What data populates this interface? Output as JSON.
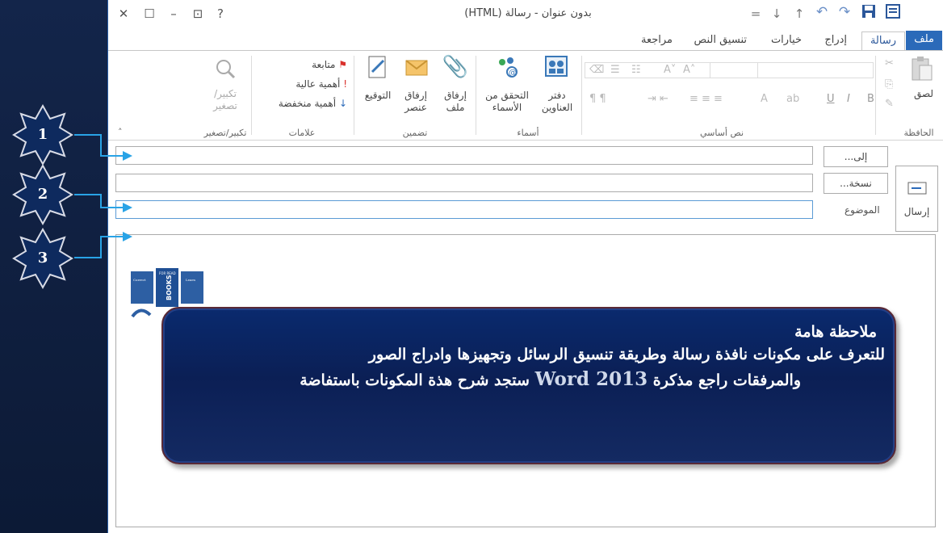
{
  "window": {
    "title": "بدون عنوان - رسالة (HTML)",
    "close_glyph": "✕",
    "maximize_glyph": "☐",
    "minimize_glyph": "–",
    "restore_glyph": "⊡",
    "help_glyph": "?"
  },
  "quick_access": {
    "save_icon": "save-icon",
    "undo_icon": "undo-icon",
    "redo_icon": "redo-icon",
    "up_icon": "up-arrow-icon",
    "down_icon": "down-arrow-icon",
    "customize_icon": "customize-icon"
  },
  "tabs": [
    {
      "label": "ملف"
    },
    {
      "label": "رسالة"
    },
    {
      "label": "إدراج"
    },
    {
      "label": "خيارات"
    },
    {
      "label": "تنسيق النص"
    },
    {
      "label": "مراجعة"
    }
  ],
  "ribbon": {
    "clipboard": {
      "paste": "لصق",
      "group": "الحافظة"
    },
    "basic_text": {
      "group": "نص أساسي",
      "bold": "B",
      "italic": "I",
      "underline": "U"
    },
    "names": {
      "address_book_1": "دفتر",
      "address_book_2": "العناوين",
      "check_names_1": "التحقق من",
      "check_names_2": "الأسماء",
      "group": "أسماء"
    },
    "include": {
      "attach_file_1": "إرفاق",
      "attach_file_2": "ملف",
      "attach_item_1": "إرفاق",
      "attach_item_2": "عنصر",
      "signature": "التوقيع",
      "group": "تضمين"
    },
    "tags": {
      "follow_up": "متابعة",
      "high_importance": "أهمية عالية",
      "low_importance": "أهمية منخفضة",
      "group": "علامات"
    },
    "zoom": {
      "zoom_1": "تكبير/",
      "zoom_2": "تصغير",
      "group": "تكبير/تصغير"
    }
  },
  "header": {
    "to_button": "إلى...",
    "cc_button": "نسخة...",
    "subject_label": "الموضوع",
    "send_button": "إرسال"
  },
  "callouts": [
    "1",
    "2",
    "3"
  ],
  "logo": {
    "left": "Correct",
    "center_top": "FOR READ",
    "center": "BOOKS",
    "right": "Learn"
  },
  "note": {
    "title": "ملاحظة هامة",
    "line1": "للتعرف على مكونات نافذة رسالة وطريقة تنسيق الرسائل وتجهيزها وادراج الصور",
    "line2_a": "والمرفقات راجع مذكرة",
    "line2_version": "Word 2013",
    "line2_b": "ستجد شرح هذة المكونات باستفاضة"
  },
  "colors": {
    "accent": "#2b6ab9",
    "callout_line": "#29a3e6",
    "note_bg": "#0b1f55"
  }
}
